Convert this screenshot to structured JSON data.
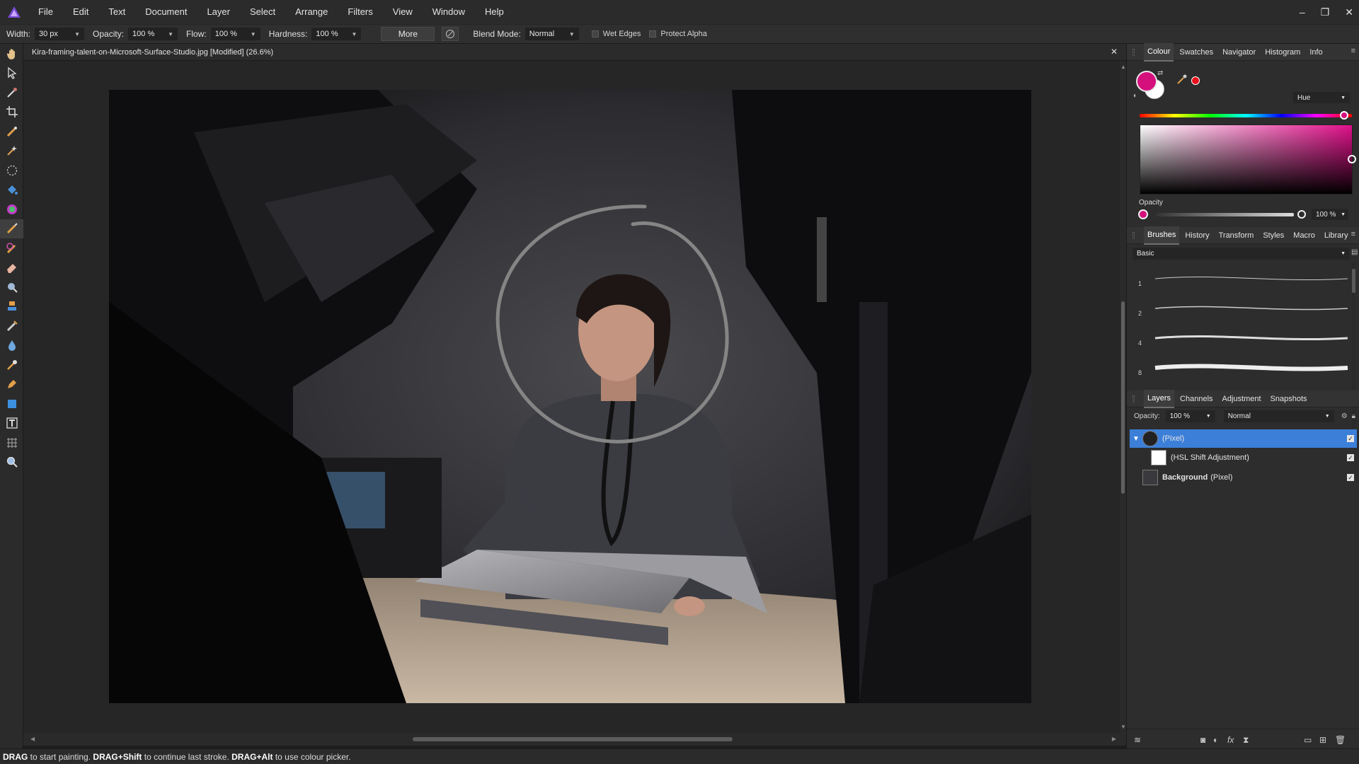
{
  "menu": [
    "File",
    "Edit",
    "Text",
    "Document",
    "Layer",
    "Select",
    "Arrange",
    "Filters",
    "View",
    "Window",
    "Help"
  ],
  "window_controls": [
    "–",
    "❐",
    "✕"
  ],
  "toolbar": {
    "width_label": "Width:",
    "width_value": "30 px",
    "opacity_label": "Opacity:",
    "opacity_value": "100 %",
    "flow_label": "Flow:",
    "flow_value": "100 %",
    "hardness_label": "Hardness:",
    "hardness_value": "100 %",
    "more_label": "More",
    "blend_label": "Blend Mode:",
    "blend_value": "Normal",
    "wet_edges_label": "Wet Edges",
    "wet_edges_checked": false,
    "protect_alpha_label": "Protect Alpha",
    "protect_alpha_checked": false
  },
  "document": {
    "title": "Kira-framing-talent-on-Microsoft-Surface-Studio.jpg [Modified] (26.6%)",
    "close_glyph": "✕"
  },
  "tools": [
    "hand-icon",
    "move-icon",
    "color-picker-icon",
    "crop-icon",
    "selection-brush-icon",
    "flood-select-icon",
    "marquee-icon",
    "flood-fill-icon",
    "gradient-icon",
    "paint-brush-icon",
    "color-replacement-icon",
    "erase-icon",
    "dodge-icon",
    "clone-icon",
    "healing-icon",
    "blur-icon",
    "smudge-icon",
    "pen-icon",
    "rectangle-icon",
    "text-icon",
    "mesh-warp-icon",
    "zoom-icon"
  ],
  "active_tool_index": 9,
  "colour_panel": {
    "tabs": [
      "Colour",
      "Swatches",
      "Navigator",
      "Histogram",
      "Info"
    ],
    "active_tab": 0,
    "primary_colour": "#d5107d",
    "secondary_colour": "#ffffff",
    "mode_value": "Hue",
    "opacity_label": "Opacity",
    "opacity_value": "100 %",
    "opacity_fraction": 1.0
  },
  "brushes_panel": {
    "tabs": [
      "Brushes",
      "History",
      "Transform",
      "Styles",
      "Macro",
      "Library"
    ],
    "active_tab": 0,
    "category_value": "Basic",
    "brush_sizes": [
      "1",
      "2",
      "4",
      "8"
    ]
  },
  "layers_panel": {
    "tabs": [
      "Layers",
      "Channels",
      "Adjustment",
      "Snapshots"
    ],
    "active_tab": 0,
    "opacity_label": "Opacity:",
    "opacity_value": "100 %",
    "blend_value": "Normal",
    "layers": [
      {
        "name": "",
        "type": "(Pixel)",
        "selected": true,
        "visible": true
      },
      {
        "name": "",
        "type": "(HSL Shift Adjustment)",
        "selected": false,
        "visible": true
      },
      {
        "name": "Background",
        "type": "(Pixel)",
        "selected": false,
        "visible": true
      }
    ]
  },
  "status": {
    "k1": "DRAG",
    "t1": " to start painting. ",
    "k2": "DRAG+Shift",
    "t2": " to continue last stroke. ",
    "k3": "DRAG+Alt",
    "t3": " to use colour picker."
  }
}
